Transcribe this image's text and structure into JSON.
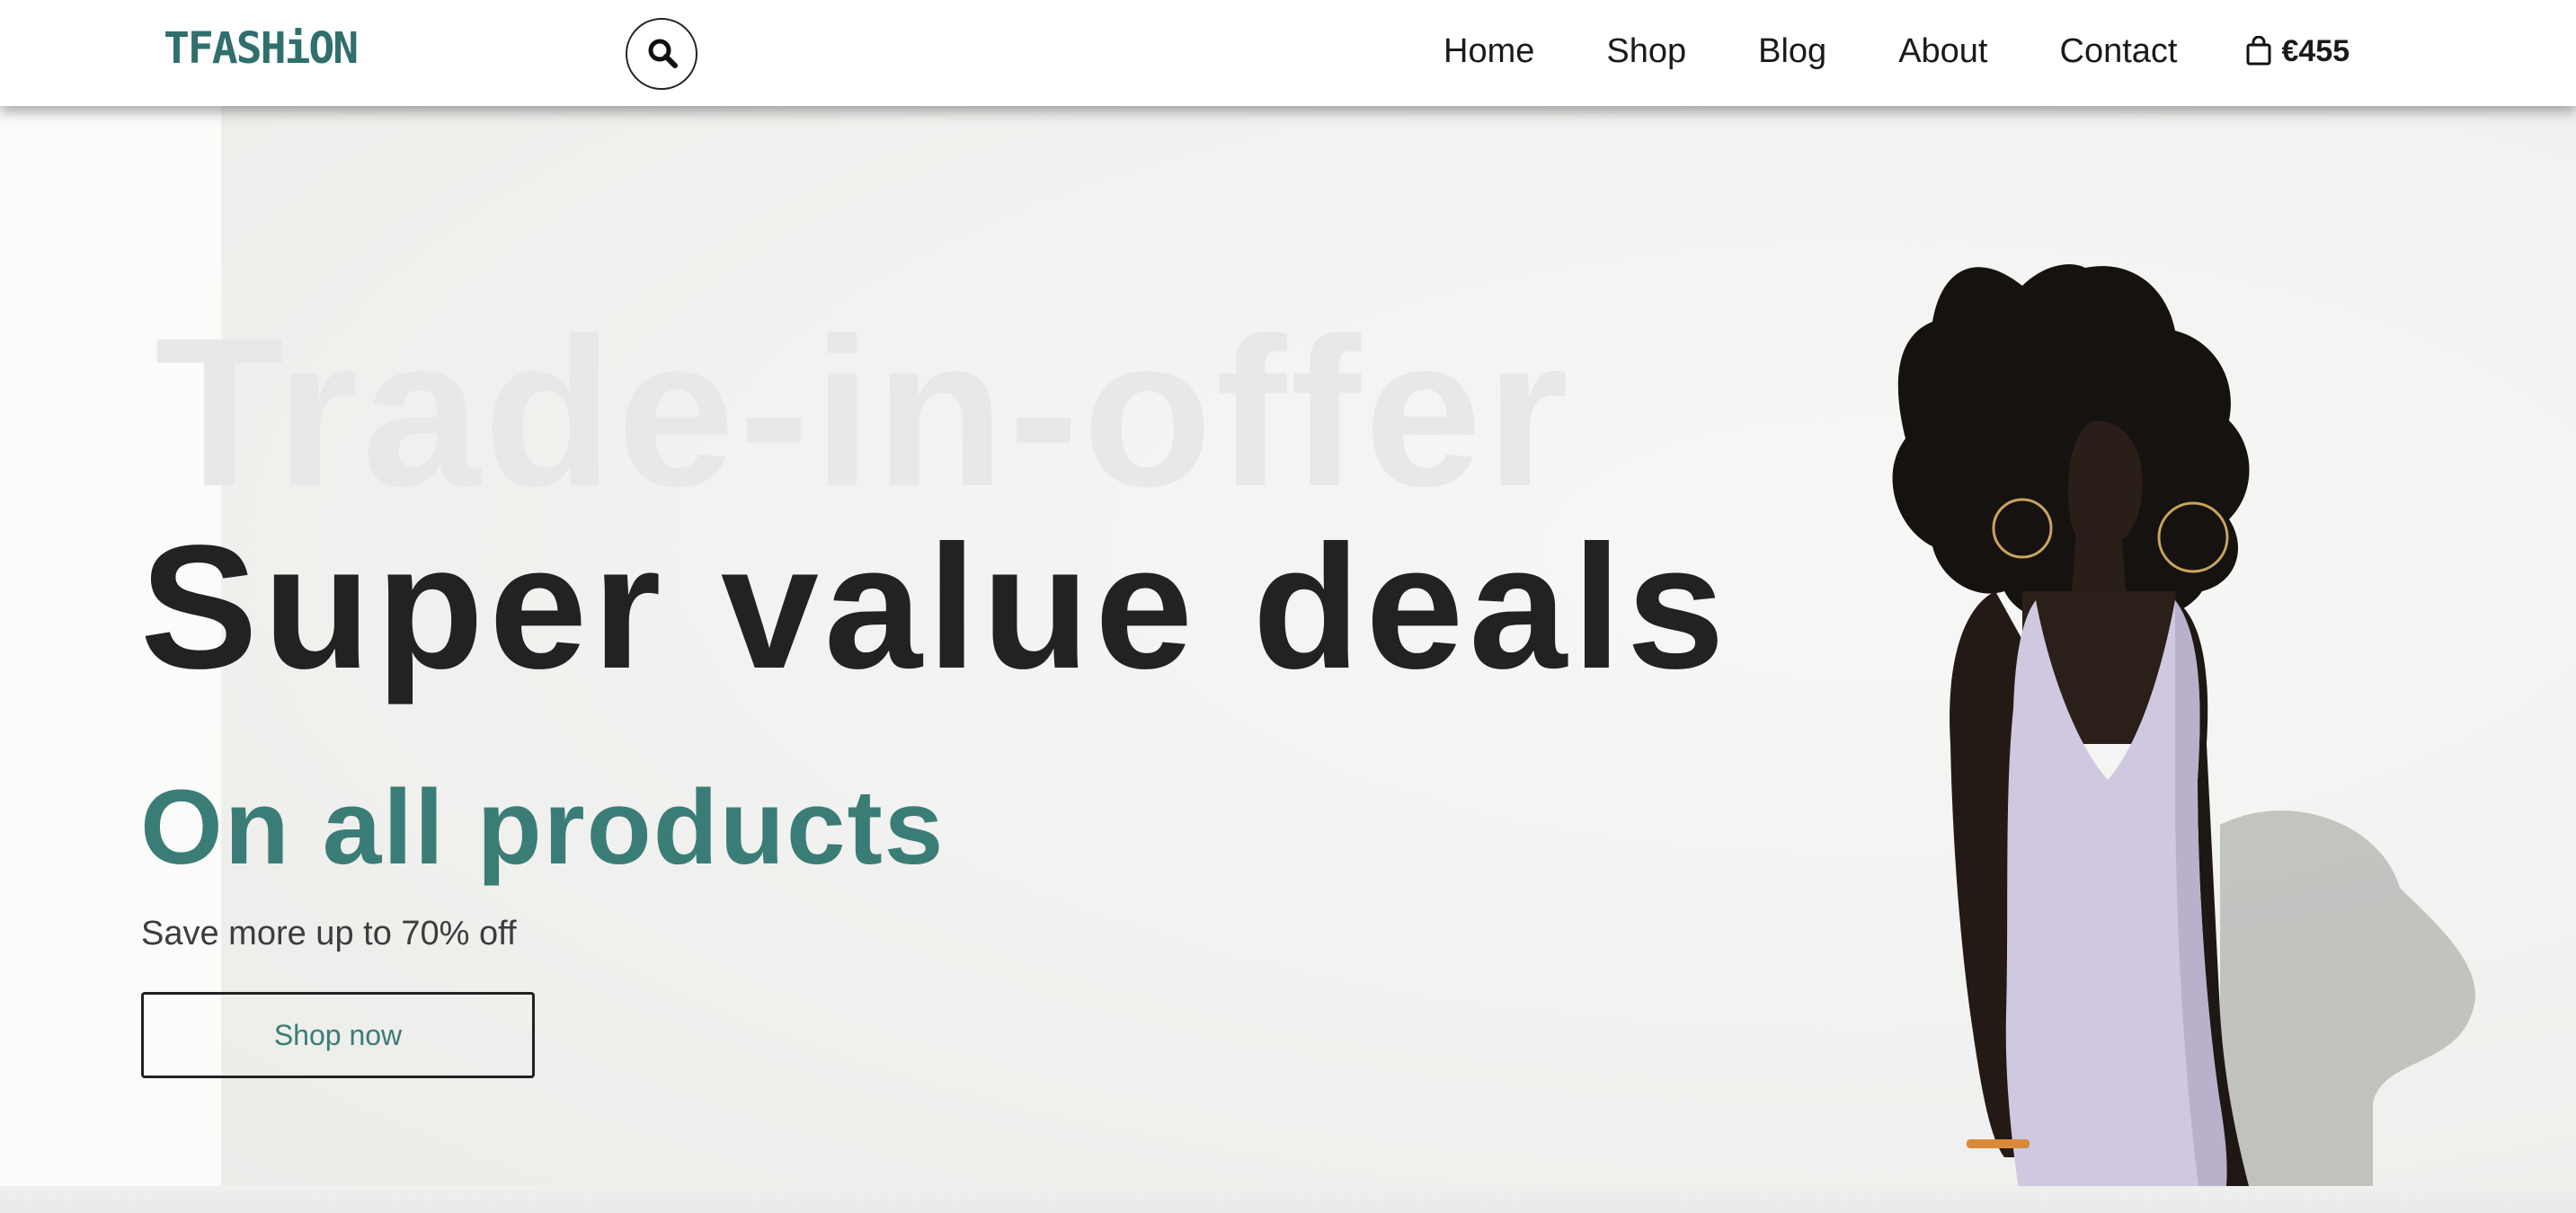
{
  "header": {
    "logo_text": "TFASHiON",
    "search_icon": "search-icon",
    "nav": [
      {
        "label": "Home"
      },
      {
        "label": "Shop"
      },
      {
        "label": "Blog"
      },
      {
        "label": "About"
      },
      {
        "label": "Contact"
      }
    ],
    "cart": {
      "icon": "shopping-bag-icon",
      "total": "€455"
    }
  },
  "hero": {
    "background_text": "Trade-in-offer",
    "headline": "Super value deals",
    "subheadline": "On all products",
    "tagline": "Save more up to 70% off",
    "button_label": "Shop now"
  },
  "colors": {
    "brand": "#2f6f6c",
    "accent": "#3a7d76",
    "headline": "#222222",
    "ghost": "#e8e8e8",
    "dress": "#cfc8e0"
  }
}
